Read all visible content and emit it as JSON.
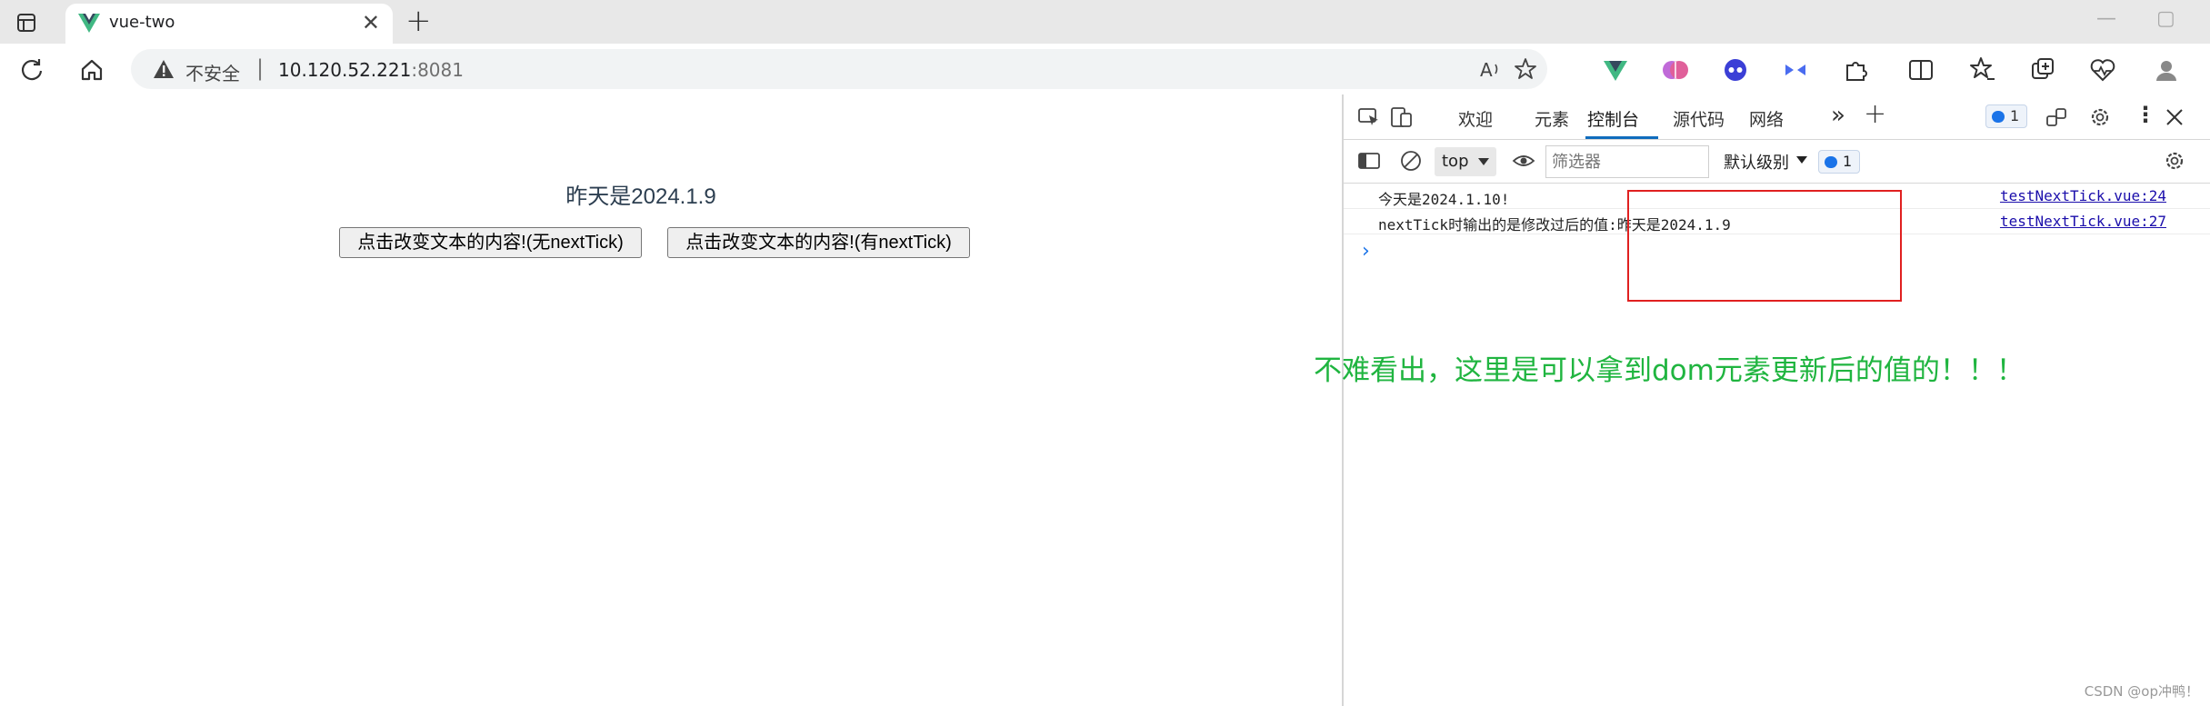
{
  "browser": {
    "tab_title": "vue-two",
    "tab_close": "✕",
    "new_tab": "+",
    "security_label": "不安全",
    "separator": "|",
    "url_host": "10.120.52.221",
    "url_port": ":8081"
  },
  "page": {
    "text": "昨天是2024.1.9",
    "button_no_nexttick": "点击改变文本的内容!(无nextTick)",
    "button_with_nexttick": "点击改变文本的内容!(有nextTick)"
  },
  "devtools": {
    "tabs": [
      "欢迎",
      "元素",
      "控制台",
      "源代码",
      "网络"
    ],
    "active_tab": "控制台",
    "more": "»",
    "add": "+",
    "message_count": "1",
    "context": "top",
    "filter_placeholder": "筛选器",
    "level": "默认级别",
    "issues_count": "1",
    "console_rows": [
      {
        "message": "今天是2024.1.10!",
        "source": "testNextTick.vue:24"
      },
      {
        "message": "nextTick时输出的是修改过后的值:昨天是2024.1.9",
        "source": "testNextTick.vue:27"
      }
    ],
    "prompt": "›"
  },
  "annotation": {
    "note": "不难看出，这里是可以拿到dom元素更新后的值的！！！",
    "highlight_color": "#e02020",
    "note_color": "#20b540"
  },
  "watermark": "CSDN @op冲鸭！",
  "icons": {
    "tab_favicon": "vue-logo-icon",
    "address_warning": "warning-icon"
  }
}
